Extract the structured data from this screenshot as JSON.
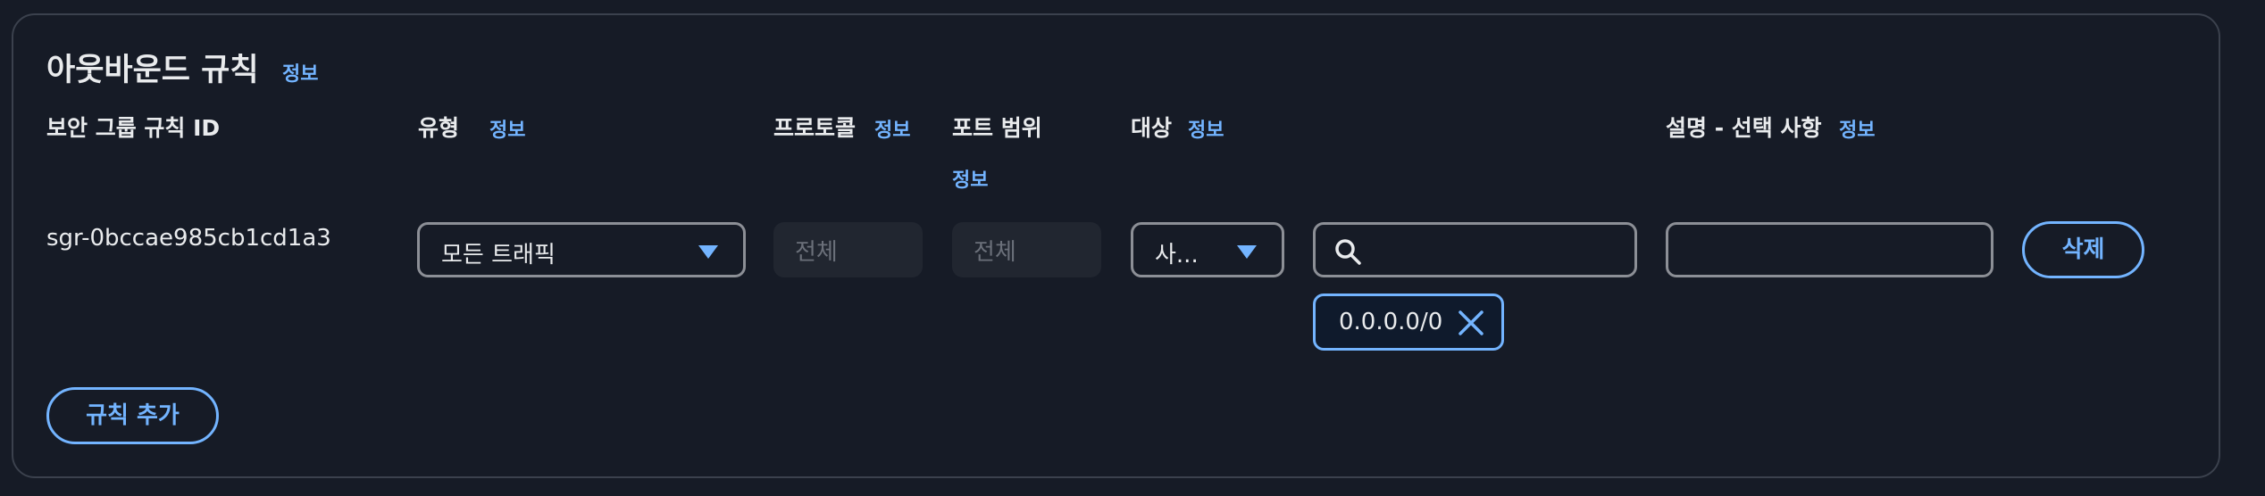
{
  "header": {
    "title": "아웃바운드 규칙",
    "info_label": "정보"
  },
  "columns": {
    "rule_id": "보안 그룹 규칙 ID",
    "type": "유형",
    "type_info": "정보",
    "protocol": "프로토콜",
    "protocol_info": "정보",
    "port_range": "포트 범위",
    "port_range_info": "정보",
    "destination": "대상",
    "destination_info": "정보",
    "description": "설명 - 선택 사항",
    "description_info": "정보"
  },
  "rule": {
    "id": "sgr-0bccae985cb1cd1a3",
    "type_value": "모든 트래픽",
    "protocol_value": "전체",
    "port_range_value": "전체",
    "destination_type_value": "사...",
    "destination_search_value": "",
    "destination_token": "0.0.0.0/0",
    "description_value": "",
    "delete_label": "삭제"
  },
  "actions": {
    "add_rule_label": "규칙 추가"
  },
  "colors": {
    "accent": "#73b4ff",
    "background": "#161b26",
    "border": "#8c8f96",
    "text": "#e9ebed",
    "disabled_bg": "#212630",
    "disabled_text": "#6b707a"
  },
  "icons": {
    "dropdown": "caret-down-icon",
    "search": "search-icon",
    "remove_token": "close-icon"
  }
}
